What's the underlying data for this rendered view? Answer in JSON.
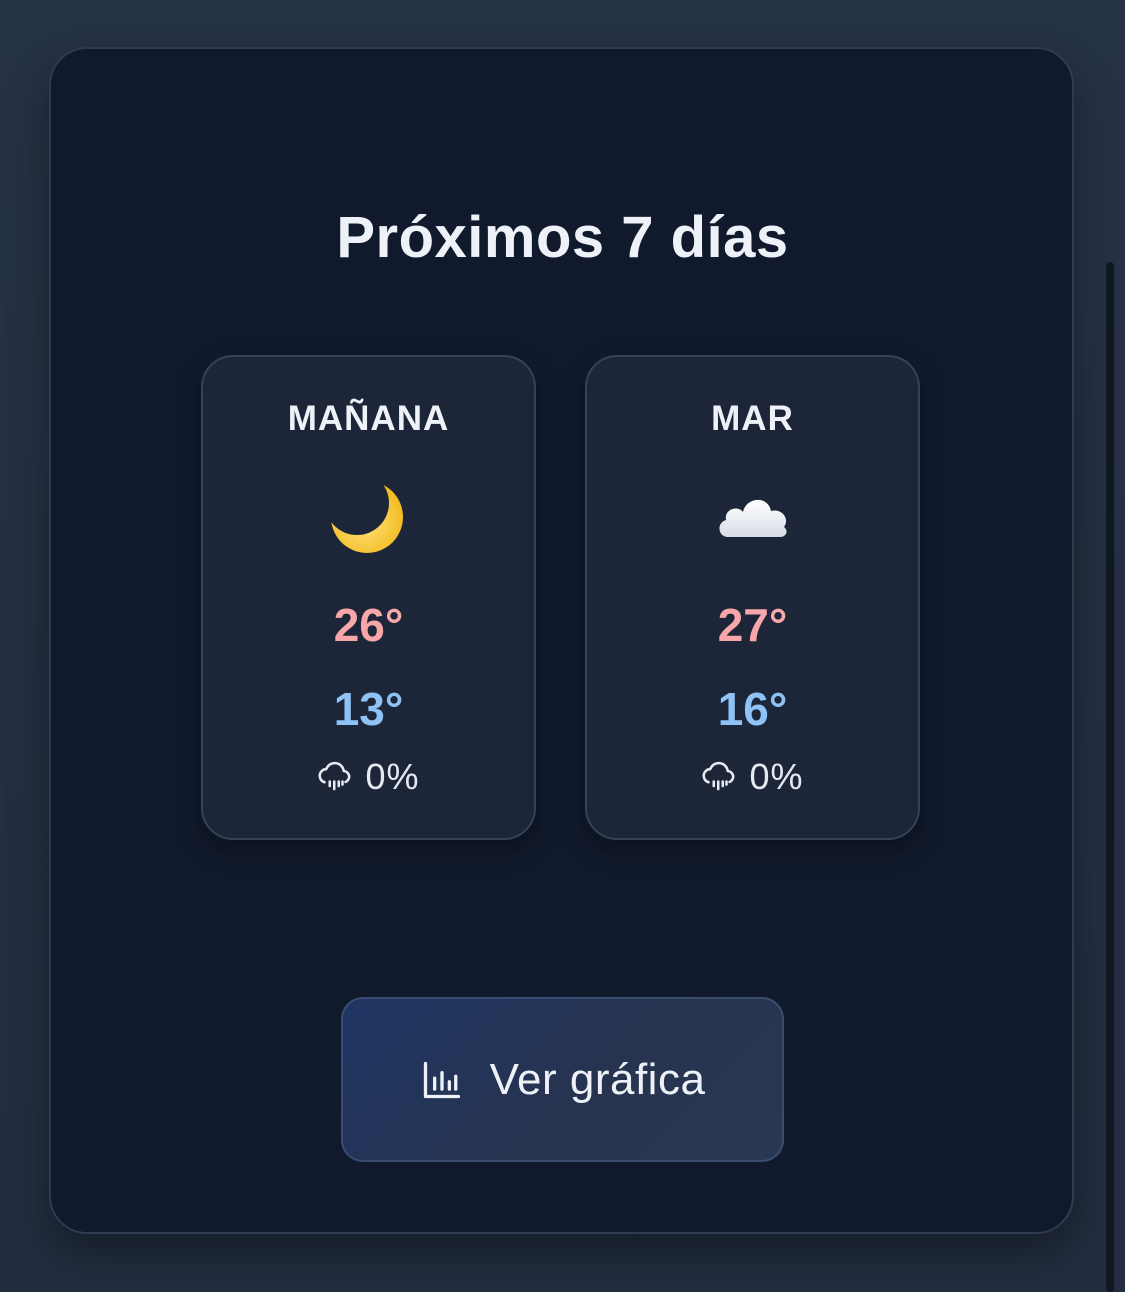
{
  "forecast": {
    "title": "Próximos 7 días",
    "days": [
      {
        "label": "MAÑANA",
        "icon": "crescent-moon-icon",
        "high": "26°",
        "low": "13°",
        "precip": "0%"
      },
      {
        "label": "MAR",
        "icon": "cloud-icon",
        "high": "27°",
        "low": "16°",
        "precip": "0%"
      }
    ],
    "chart_button_label": "Ver gráfica"
  },
  "colors": {
    "panel_bg": "#111a2c",
    "card_bg": "#1c2638",
    "high_temp": "#f7a7a9",
    "low_temp": "#8fc2f5",
    "text": "#eef2f8",
    "button_bg": "#1f3563"
  }
}
